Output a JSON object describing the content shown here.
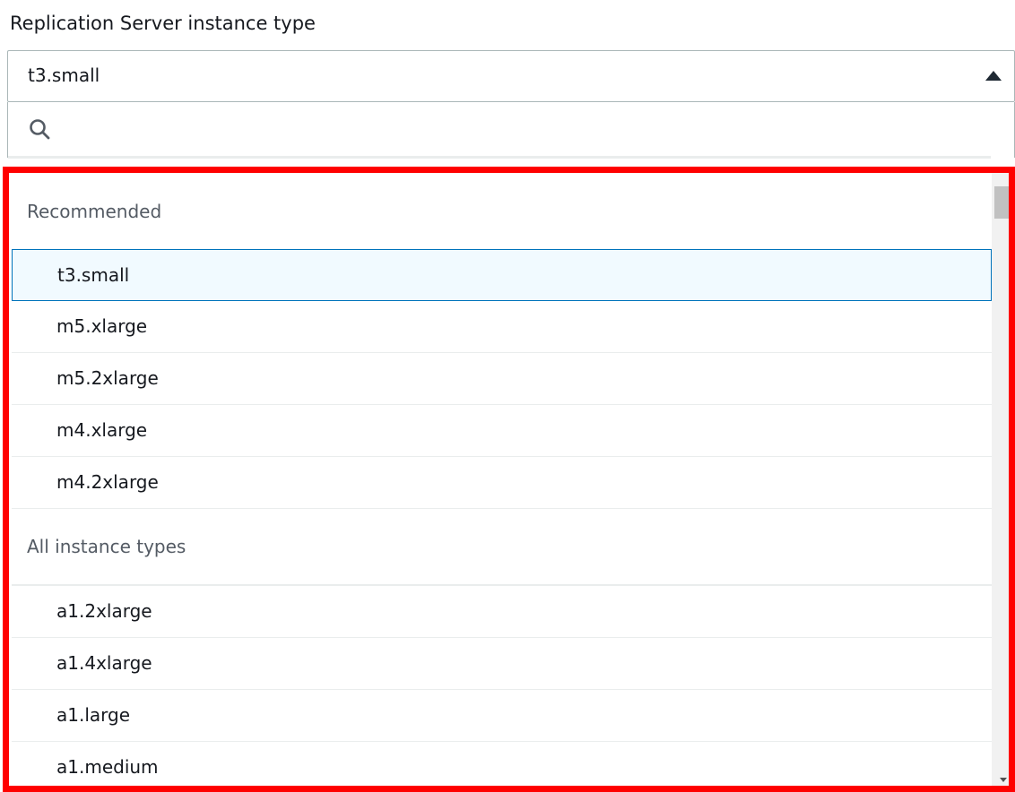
{
  "field": {
    "label": "Replication Server instance type",
    "selected_value": "t3.small"
  },
  "search": {
    "placeholder": ""
  },
  "groups": [
    {
      "header": "Recommended",
      "options": [
        "t3.small",
        "m5.xlarge",
        "m5.2xlarge",
        "m4.xlarge",
        "m4.2xlarge"
      ]
    },
    {
      "header": "All instance types",
      "options": [
        "a1.2xlarge",
        "a1.4xlarge",
        "a1.large",
        "a1.medium"
      ]
    }
  ],
  "highlight_color": "#ff0000",
  "selected_option_border": "#0073bb"
}
